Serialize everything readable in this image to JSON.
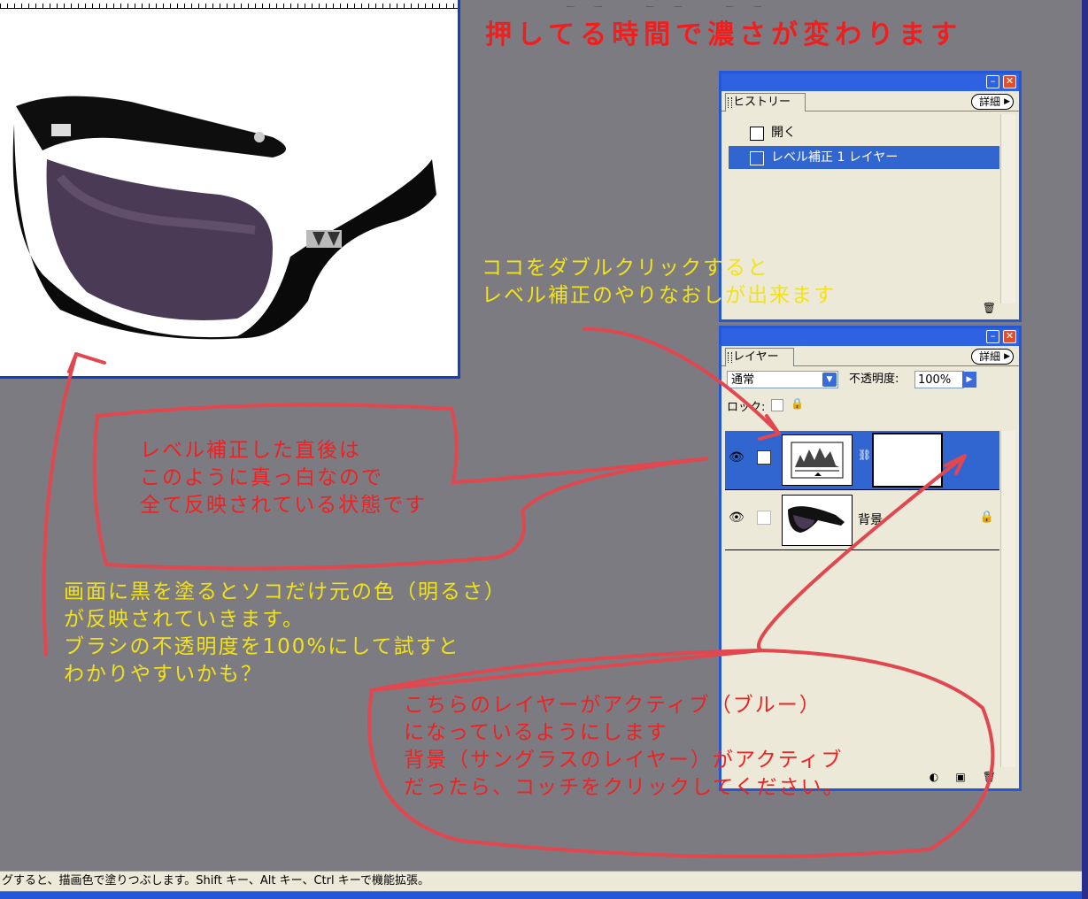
{
  "heading": "押してる時間で濃さが変わります",
  "history_panel": {
    "tab": "ヒストリー",
    "detail_button": "詳細",
    "items": [
      {
        "label": "開く",
        "selected": false
      },
      {
        "label": "レベル補正 1 レイヤー",
        "selected": true
      }
    ]
  },
  "layers_panel": {
    "tab": "レイヤー",
    "detail_button": "詳細",
    "blend_mode": "通常",
    "opacity_label": "不透明度:",
    "opacity_value": "100%",
    "lock_label": "ロック:",
    "layers": [
      {
        "name": "",
        "type": "adjustment",
        "selected": true
      },
      {
        "name": "背景",
        "type": "image",
        "selected": false
      }
    ]
  },
  "annotations": {
    "double_click": [
      "ココをダブルクリックすると",
      "レベル補正のやりなおしが出来ます"
    ],
    "after_level": [
      "レベル補正した直後は",
      "このように真っ白なので",
      "全て反映されている状態です"
    ],
    "paint_black": [
      "画面に黒を塗るとソコだけ元の色（明るさ）",
      "が反映されていきます。",
      "ブラシの不透明度を100%にして試すと",
      "わかりやすいかも？"
    ],
    "active_layer": [
      "こちらのレイヤーがアクティブ（ブルー）",
      "になっているようにします",
      "背景（サングラスのレイヤー）がアクティブ",
      "だったら、コッチをクリックしてください。"
    ]
  },
  "status_bar": "グすると、描画色で塗りつぶします。Shift キー、Alt キー、Ctrl キーで機能拡張。",
  "colors": {
    "accent_red": "#ee2222",
    "accent_yellow": "#f2e21a",
    "selection_blue": "#3166d1",
    "window_blue": "#2456d8",
    "background_gray": "#7c7b82"
  },
  "icons": [
    "document-icon",
    "eye-icon",
    "lock-icon",
    "trash-icon",
    "new-layer-icon",
    "adjustment-layer-icon",
    "chain-icon",
    "minimize-icon",
    "close-icon",
    "dropdown-arrow-icon"
  ]
}
